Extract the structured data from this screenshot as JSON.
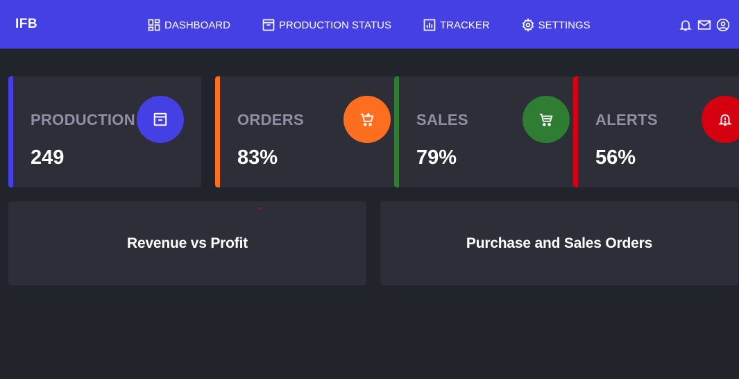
{
  "brand": "IFB",
  "nav": [
    {
      "label": "DASHBOARD",
      "icon": "dashboard-icon"
    },
    {
      "label": "PRODUCTION STATUS",
      "icon": "archive-icon"
    },
    {
      "label": "TRACKER",
      "icon": "bar-chart-icon"
    },
    {
      "label": "SETTINGS",
      "icon": "gear-icon"
    }
  ],
  "header_icons": [
    "bell-icon",
    "mail-icon",
    "user-circle-icon"
  ],
  "cards": [
    {
      "label": "PRODUCTION",
      "value": "249",
      "color": "#4540e4",
      "icon": "archive-icon"
    },
    {
      "label": "ORDERS",
      "value": "83%",
      "color": "#fd6f1f",
      "icon": "cart-add-icon"
    },
    {
      "label": "SALES",
      "value": "79%",
      "color": "#2f7d32",
      "icon": "cart-icon"
    },
    {
      "label": "ALERTS",
      "value": "56%",
      "color": "#d50010",
      "icon": "bell-alert-icon"
    }
  ],
  "panels": [
    {
      "title": "Revenue vs Profit"
    },
    {
      "title": "Purchase and Sales Orders"
    }
  ],
  "colors": {
    "header": "#4540e4",
    "background": "#22242b",
    "card": "#2d2e38",
    "muted_text": "#8f90a6"
  }
}
